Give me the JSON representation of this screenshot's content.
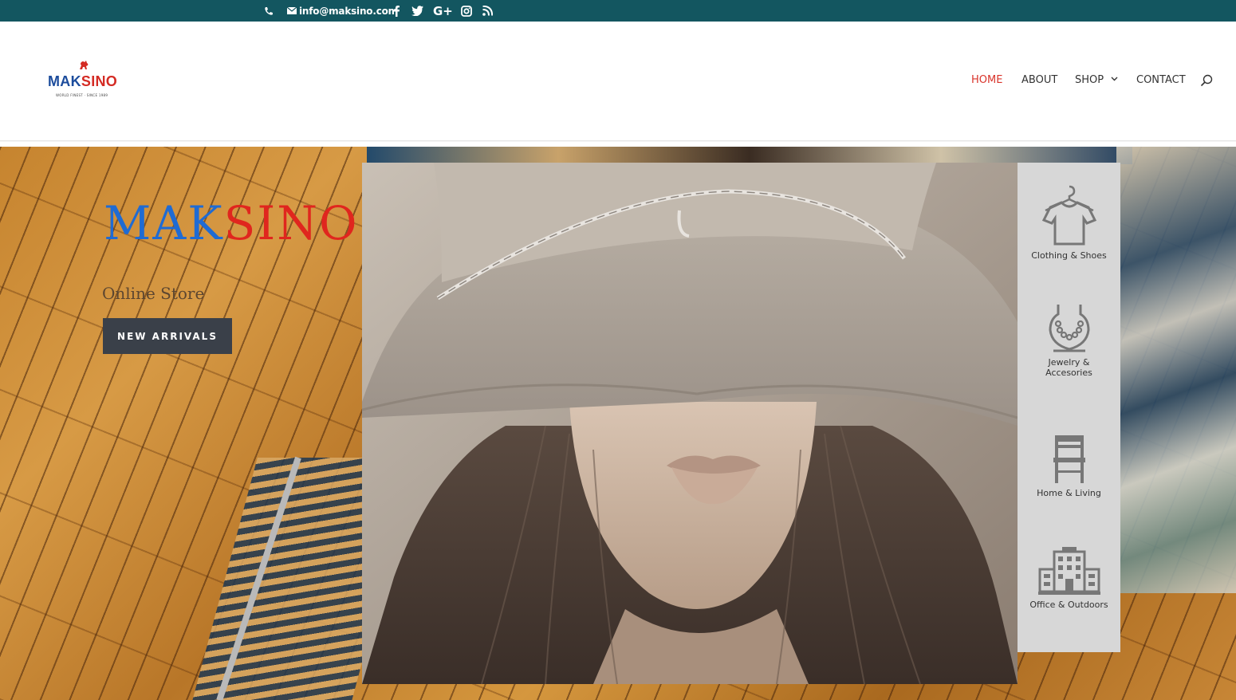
{
  "topbar": {
    "email": "info@maksino.com",
    "icons": [
      "phone-icon",
      "envelope-icon",
      "facebook-icon",
      "twitter-icon",
      "google-plus-icon",
      "instagram-icon",
      "rss-icon"
    ],
    "gplus_text": "G+"
  },
  "header": {
    "logo": {
      "part1": "MAK",
      "part2": "SINO",
      "tagline": "WORLD FINEST · SINCE 1989"
    },
    "nav": {
      "home": "HOME",
      "about": "ABOUT",
      "shop": "SHOP",
      "contact": "CONTACT"
    },
    "active_color": "#d9342b"
  },
  "hero": {
    "title_part1": "MAK",
    "title_part2": "SINO",
    "subtitle": "Online Store",
    "button": "NEW ARRIVALS"
  },
  "categories": [
    {
      "label": "Clothing & Shoes",
      "icon": "tshirt-hanger-icon"
    },
    {
      "label": "Jewelry & Accesories",
      "icon": "necklace-icon"
    },
    {
      "label": "Home & Living",
      "icon": "chair-icon"
    },
    {
      "label": "Office & Outdoors",
      "icon": "building-icon"
    }
  ],
  "colors": {
    "topbar": "#135660",
    "brand_blue": "#1f6bd3",
    "brand_red": "#e0261e",
    "button": "#3a4049",
    "panel": "#d7d7d7"
  }
}
